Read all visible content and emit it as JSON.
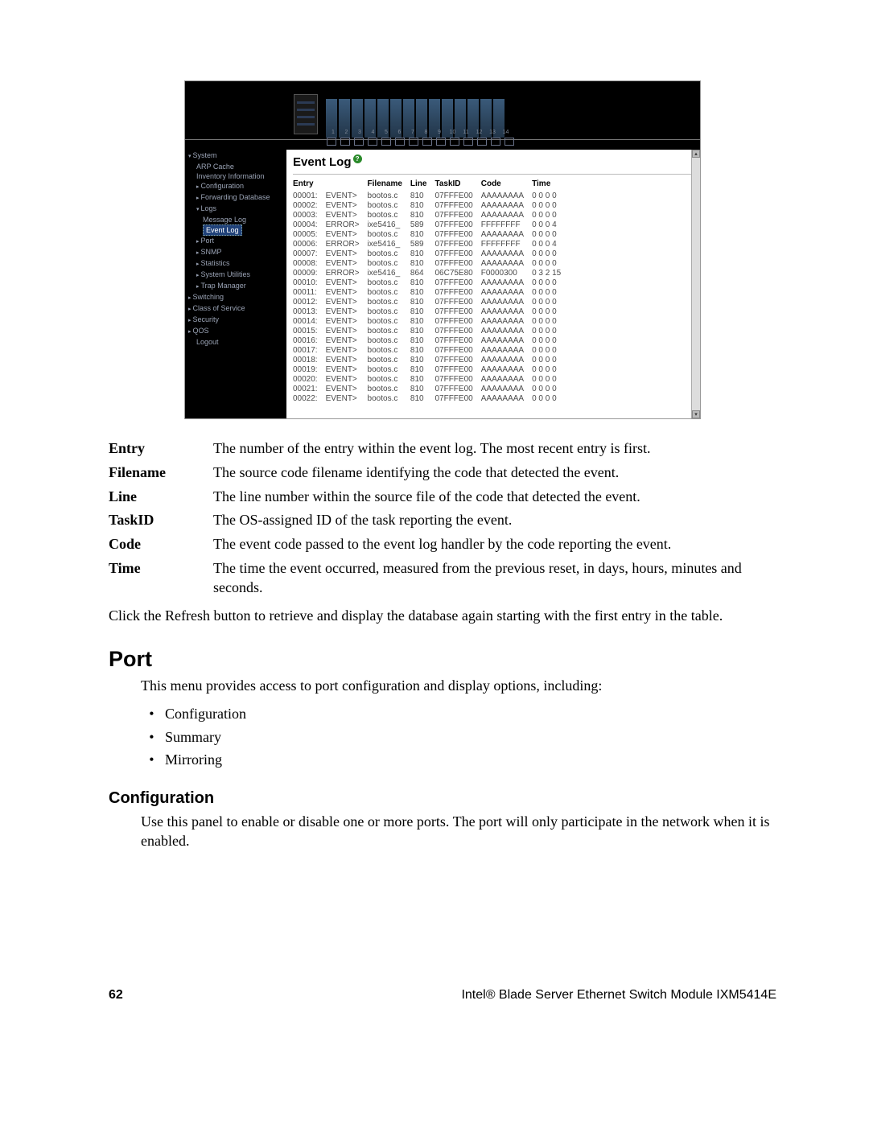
{
  "screenshot": {
    "title": "Event Log",
    "port_numbers": [
      "1",
      "2",
      "3",
      "4",
      "5",
      "6",
      "7",
      "8",
      "9",
      "10",
      "11",
      "12",
      "13",
      "14"
    ],
    "sidebar": [
      {
        "label": "System",
        "depth": 0,
        "cls": "open"
      },
      {
        "label": "ARP Cache",
        "depth": 1
      },
      {
        "label": "Inventory Information",
        "depth": 1
      },
      {
        "label": "Configuration",
        "depth": 1,
        "cls": "caret"
      },
      {
        "label": "Forwarding Database",
        "depth": 1,
        "cls": "caret"
      },
      {
        "label": "Logs",
        "depth": 1,
        "cls": "open"
      },
      {
        "label": "Message Log",
        "depth": 2
      },
      {
        "label": "Event Log",
        "depth": 2,
        "selected": true
      },
      {
        "label": "Port",
        "depth": 1,
        "cls": "caret"
      },
      {
        "label": "SNMP",
        "depth": 1,
        "cls": "caret"
      },
      {
        "label": "Statistics",
        "depth": 1,
        "cls": "caret"
      },
      {
        "label": "System Utilities",
        "depth": 1,
        "cls": "caret"
      },
      {
        "label": "Trap Manager",
        "depth": 1,
        "cls": "caret"
      },
      {
        "label": "Switching",
        "depth": 0,
        "cls": "caret"
      },
      {
        "label": "Class of Service",
        "depth": 0,
        "cls": "caret"
      },
      {
        "label": "Security",
        "depth": 0,
        "cls": "caret"
      },
      {
        "label": "QOS",
        "depth": 0,
        "cls": "caret"
      },
      {
        "label": "Logout",
        "depth": 1
      }
    ],
    "headers": [
      "Entry",
      "",
      "Filename",
      "Line",
      "TaskID",
      "Code",
      "Time"
    ],
    "rows": [
      [
        "00001:",
        "EVENT>",
        "bootos.c",
        "810",
        "07FFFE00",
        "AAAAAAAA",
        "0 0 0 0"
      ],
      [
        "00002:",
        "EVENT>",
        "bootos.c",
        "810",
        "07FFFE00",
        "AAAAAAAA",
        "0 0 0 0"
      ],
      [
        "00003:",
        "EVENT>",
        "bootos.c",
        "810",
        "07FFFE00",
        "AAAAAAAA",
        "0 0 0 0"
      ],
      [
        "00004:",
        "ERROR>",
        "ixe5416_",
        "589",
        "07FFFE00",
        "FFFFFFFF",
        "0 0 0 4"
      ],
      [
        "00005:",
        "EVENT>",
        "bootos.c",
        "810",
        "07FFFE00",
        "AAAAAAAA",
        "0 0 0 0"
      ],
      [
        "00006:",
        "ERROR>",
        "ixe5416_",
        "589",
        "07FFFE00",
        "FFFFFFFF",
        "0 0 0 4"
      ],
      [
        "00007:",
        "EVENT>",
        "bootos.c",
        "810",
        "07FFFE00",
        "AAAAAAAA",
        "0 0 0 0"
      ],
      [
        "00008:",
        "EVENT>",
        "bootos.c",
        "810",
        "07FFFE00",
        "AAAAAAAA",
        "0 0 0 0"
      ],
      [
        "00009:",
        "ERROR>",
        "ixe5416_",
        "864",
        "06C75E80",
        "F0000300",
        "0 3 2 15"
      ],
      [
        "00010:",
        "EVENT>",
        "bootos.c",
        "810",
        "07FFFE00",
        "AAAAAAAA",
        "0 0 0 0"
      ],
      [
        "00011:",
        "EVENT>",
        "bootos.c",
        "810",
        "07FFFE00",
        "AAAAAAAA",
        "0 0 0 0"
      ],
      [
        "00012:",
        "EVENT>",
        "bootos.c",
        "810",
        "07FFFE00",
        "AAAAAAAA",
        "0 0 0 0"
      ],
      [
        "00013:",
        "EVENT>",
        "bootos.c",
        "810",
        "07FFFE00",
        "AAAAAAAA",
        "0 0 0 0"
      ],
      [
        "00014:",
        "EVENT>",
        "bootos.c",
        "810",
        "07FFFE00",
        "AAAAAAAA",
        "0 0 0 0"
      ],
      [
        "00015:",
        "EVENT>",
        "bootos.c",
        "810",
        "07FFFE00",
        "AAAAAAAA",
        "0 0 0 0"
      ],
      [
        "00016:",
        "EVENT>",
        "bootos.c",
        "810",
        "07FFFE00",
        "AAAAAAAA",
        "0 0 0 0"
      ],
      [
        "00017:",
        "EVENT>",
        "bootos.c",
        "810",
        "07FFFE00",
        "AAAAAAAA",
        "0 0 0 0"
      ],
      [
        "00018:",
        "EVENT>",
        "bootos.c",
        "810",
        "07FFFE00",
        "AAAAAAAA",
        "0 0 0 0"
      ],
      [
        "00019:",
        "EVENT>",
        "bootos.c",
        "810",
        "07FFFE00",
        "AAAAAAAA",
        "0 0 0 0"
      ],
      [
        "00020:",
        "EVENT>",
        "bootos.c",
        "810",
        "07FFFE00",
        "AAAAAAAA",
        "0 0 0 0"
      ],
      [
        "00021:",
        "EVENT>",
        "bootos.c",
        "810",
        "07FFFE00",
        "AAAAAAAA",
        "0 0 0 0"
      ],
      [
        "00022:",
        "EVENT>",
        "bootos.c",
        "810",
        "07FFFE00",
        "AAAAAAAA",
        "0 0 0 0"
      ]
    ]
  },
  "defs": [
    {
      "term": "Entry",
      "desc": "The number of the entry within the event log. The most recent entry is first."
    },
    {
      "term": "Filename",
      "desc": "The source code filename identifying the code that detected the event."
    },
    {
      "term": "Line",
      "desc": "The line number within the source file of the code that detected the event."
    },
    {
      "term": "TaskID",
      "desc": "The OS-assigned ID of the task reporting the event."
    },
    {
      "term": "Code",
      "desc": "The event code passed to the event log handler by the code reporting the event."
    },
    {
      "term": "Time",
      "desc": "The time the event occurred, measured from the previous reset, in days, hours, minutes and seconds."
    }
  ],
  "refresh_note": "Click the Refresh button to retrieve and display the database again starting with the first entry in the table.",
  "port_heading": "Port",
  "port_intro": "This menu provides access to port configuration and display options, including:",
  "port_items": [
    "Configuration",
    "Summary",
    "Mirroring"
  ],
  "config_heading": "Configuration",
  "config_text": "Use this panel to enable or disable one or more ports. The port will only participate in the network when it is enabled.",
  "footer": {
    "page": "62",
    "title": "Intel® Blade Server Ethernet Switch Module IXM5414E"
  }
}
